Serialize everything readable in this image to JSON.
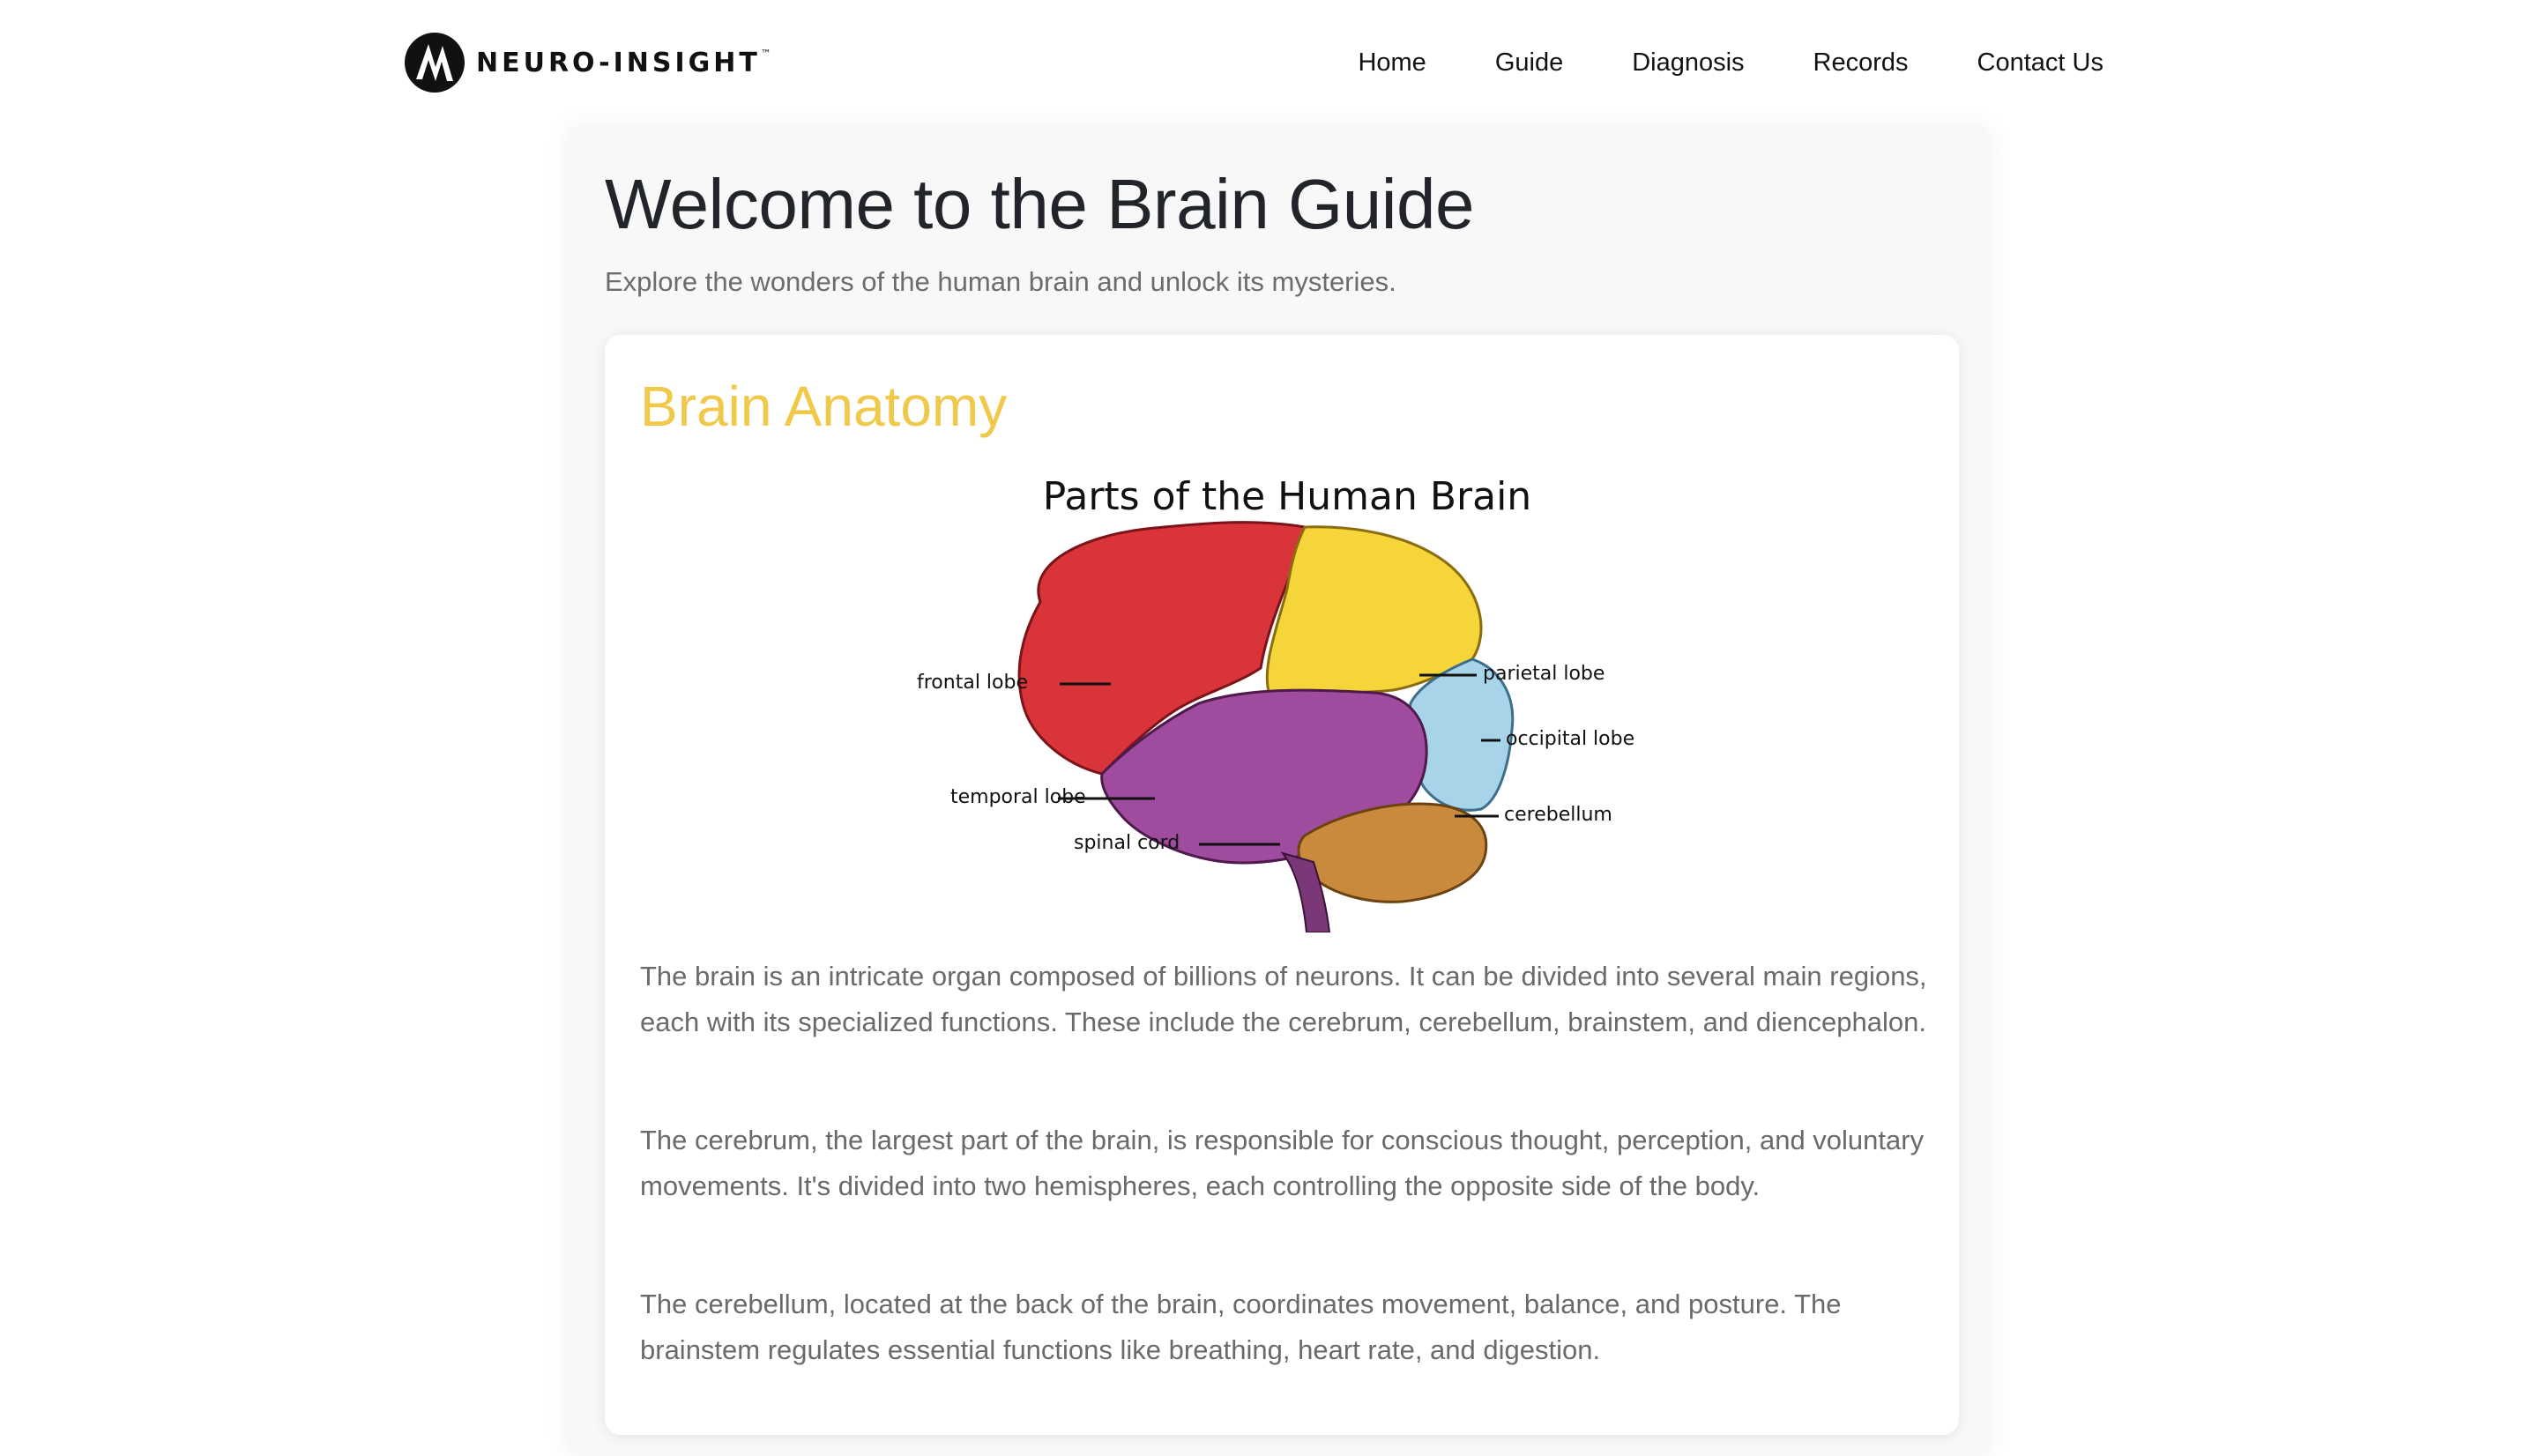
{
  "header": {
    "logo_text": "NEURO-INSIGHT",
    "logo_tm": "™",
    "nav": [
      "Home",
      "Guide",
      "Diagnosis",
      "Records",
      "Contact Us"
    ]
  },
  "hero": {
    "title": "Welcome to the Brain Guide",
    "subtitle": "Explore the wonders of the human brain and unlock its mysteries."
  },
  "anatomy": {
    "title": "Brain Anatomy",
    "figure": {
      "title": "Parts of the Human Brain",
      "labels": {
        "frontal": "frontal lobe",
        "parietal": "parietal lobe",
        "occipital": "occipital lobe",
        "temporal": "temporal lobe",
        "cerebellum": "cerebellum",
        "spinal": "spinal cord"
      }
    },
    "paragraphs": [
      "The brain is an intricate organ composed of billions of neurons. It can be divided into several main regions, each with its specialized functions. These include the cerebrum, cerebellum, brainstem, and diencephalon.",
      "The cerebrum, the largest part of the brain, is responsible for conscious thought, perception, and voluntary movements. It's divided into two hemispheres, each controlling the opposite side of the body.",
      "The cerebellum, located at the back of the brain, coordinates movement, balance, and posture. The brainstem regulates essential functions like breathing, heart rate, and digestion."
    ]
  },
  "colors": {
    "accent_title": "#f0c94a",
    "frontal": "#d8343a",
    "parietal": "#f5d53a",
    "occipital": "#a8d4ea",
    "temporal": "#a04c9e",
    "cerebellum": "#c98a3e"
  }
}
